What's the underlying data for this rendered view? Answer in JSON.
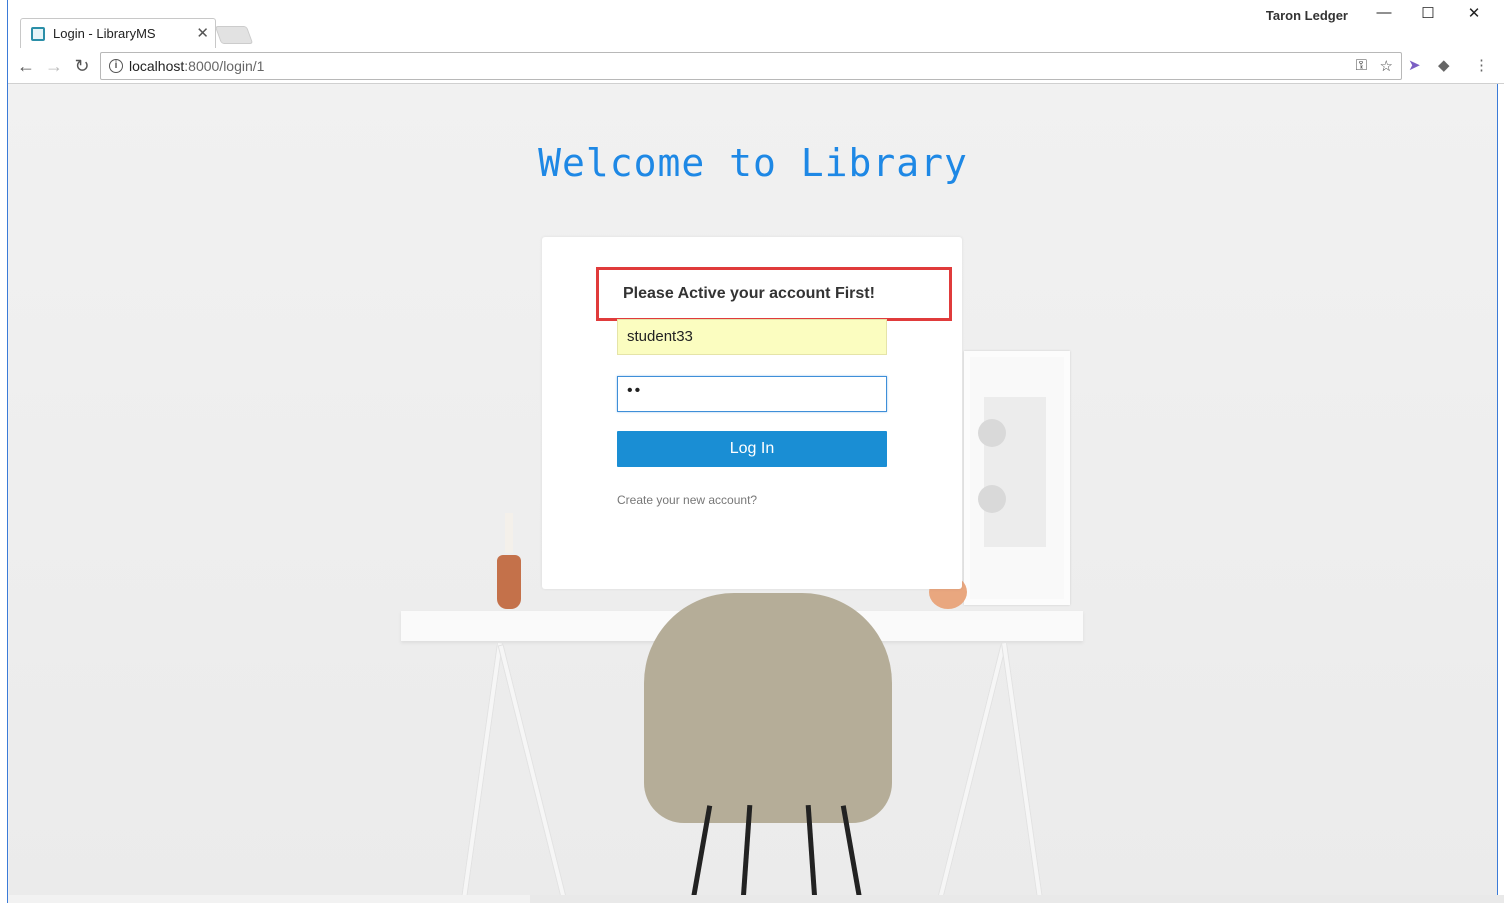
{
  "browser": {
    "tab_title": "Login - LibraryMS",
    "tab_close": "✕",
    "profile_name": "Taron Ledger",
    "url_host": "localhost",
    "url_rest": ":8000/login/1",
    "win_minimize": "—",
    "win_maximize": "☐",
    "win_close": "✕",
    "nav_back": "←",
    "nav_forward": "→",
    "nav_reload": "↻",
    "menu": "⋮"
  },
  "page": {
    "heading": "Welcome to Library",
    "alert": "Please Active your account First!",
    "username_value": "student33",
    "password_masked": "••",
    "login_label": "Log In",
    "create_account_label": "Create your new account?"
  },
  "colors": {
    "heading": "#1e88e5",
    "alert_border": "#e03b3b",
    "button": "#1a8ed4",
    "autofill": "#fbfdc0"
  }
}
